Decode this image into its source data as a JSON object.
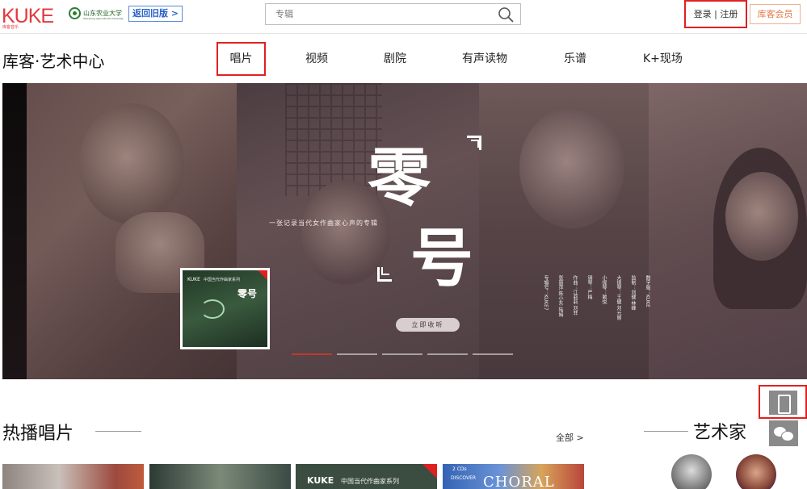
{
  "header": {
    "logo_text": "KUKE",
    "logo_sub": "库客音乐",
    "school_name": "山东农业大学",
    "school_en": "Shandong Agricultural University",
    "return_label": "返回旧版 >",
    "search_placeholder": "专辑",
    "login_label": "登录 | 注册",
    "vip_label": "库客会员"
  },
  "site_title": "库客·艺术中心",
  "nav": {
    "items": [
      {
        "label": "唱片",
        "active": true
      },
      {
        "label": "视频"
      },
      {
        "label": "剧院"
      },
      {
        "label": "有声读物"
      },
      {
        "label": "乐谱"
      },
      {
        "label": "K+现场"
      }
    ]
  },
  "banner": {
    "char1": "零",
    "char2": "号",
    "tagline": "一张记录当代女作曲家心声的专辑",
    "listen_label": "立即收听",
    "album_brand": "KUKE",
    "album_series": "中国当代作曲家系列",
    "album_title": "零号",
    "credits": [
      "专辑号：KUKE7",
      "张丽萍  陈小东  陆娟",
      "作曲：江莉莉  刘菲",
      "钢琴：严梅",
      "小提琴：赖悦",
      "大提琴：王健  刘元丽",
      "监制：刘健  林峰",
      "数字版：KUKE"
    ],
    "slides": 5,
    "active_slide": 0
  },
  "sections": {
    "hot_title": "热播唱片",
    "all_label": "全部 >",
    "artist_title": "艺术家"
  },
  "thumbs": {
    "t3_brand": "KUKE",
    "t3_series": "中国当代作曲家系列",
    "t4_cd": "2 CDs",
    "t4_disc": "DISCOVER",
    "t4_title": "CHORAL"
  }
}
